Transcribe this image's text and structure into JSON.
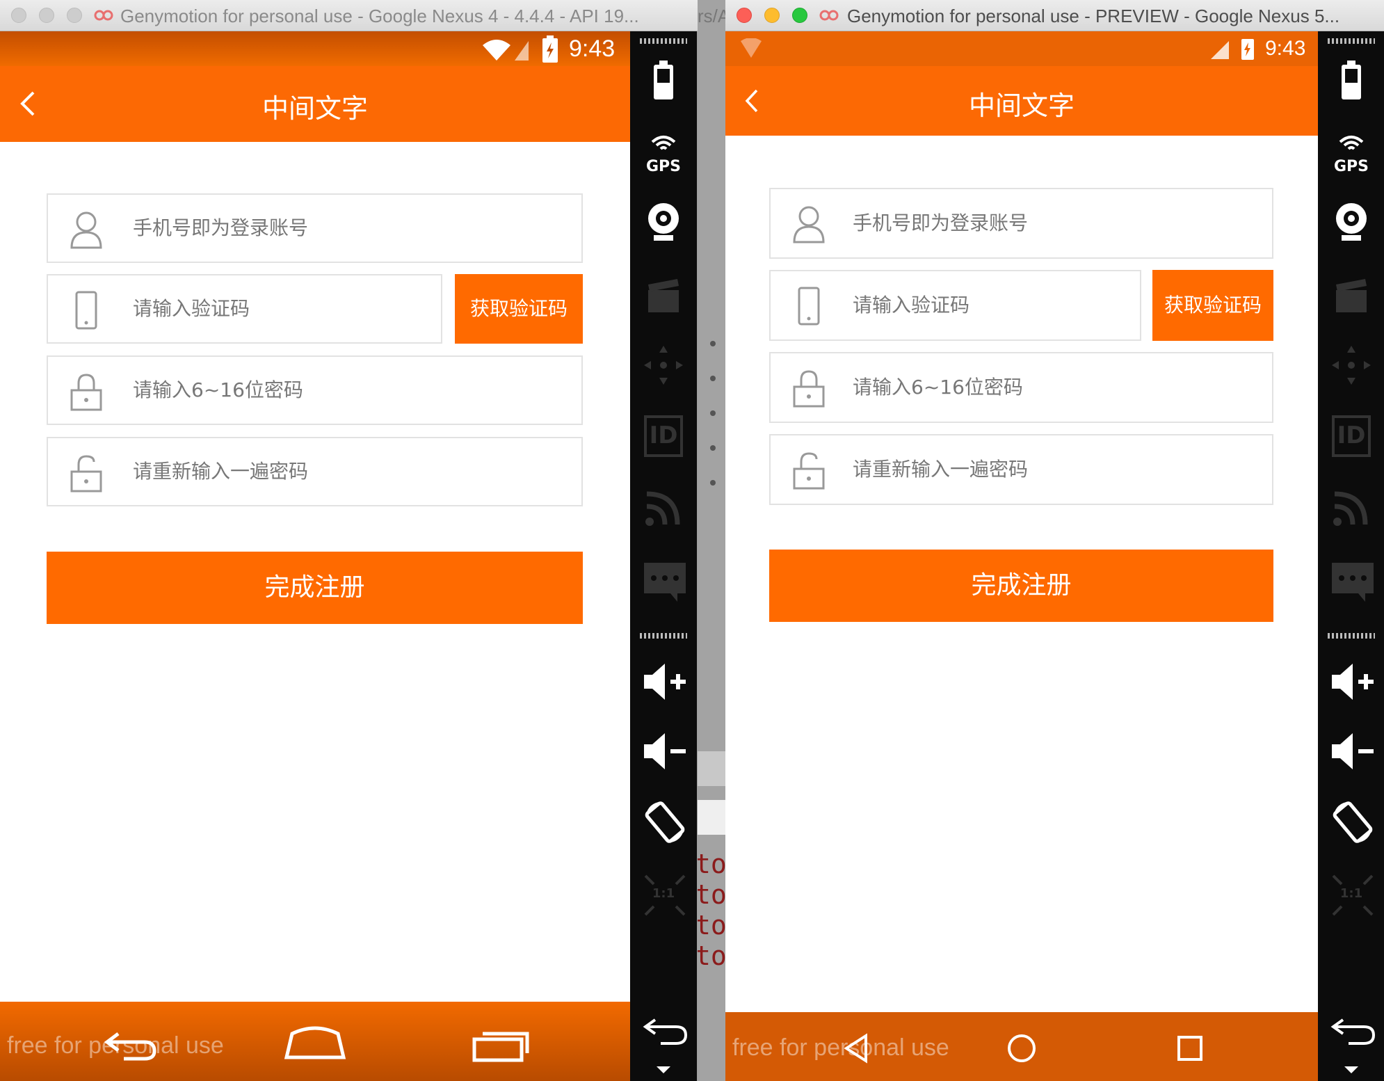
{
  "left_window": {
    "title": "Genymotion for personal use - Google Nexus 4 - 4.4.4 - API 19...",
    "status_time": "9:43",
    "app_title": "中间文字",
    "fields": {
      "phone_placeholder": "手机号即为登录账号",
      "code_placeholder": "请输入验证码",
      "password_placeholder": "请输入6~16位密码",
      "confirm_placeholder": "请重新输入一遍密码"
    },
    "get_code_label": "获取验证码",
    "submit_label": "完成注册",
    "watermark": "free for personal use",
    "sidebar_gps_label": "GPS",
    "sidebar_id_label": "ID",
    "sidebar_scale_label": "1:1"
  },
  "right_window": {
    "title": "Genymotion for personal use - PREVIEW - Google Nexus 5...",
    "status_time": "9:43",
    "app_title": "中间文字",
    "fields": {
      "phone_placeholder": "手机号即为登录账号",
      "code_placeholder": "请输入验证码",
      "password_placeholder": "请输入6~16位密码",
      "confirm_placeholder": "请重新输入一遍密码"
    },
    "get_code_label": "获取验证码",
    "submit_label": "完成注册",
    "watermark": "free for personal use",
    "sidebar_gps_label": "GPS",
    "sidebar_id_label": "ID",
    "sidebar_scale_label": "1:1"
  },
  "background_window": {
    "fragments": [
      "rs/A",
      "rs/A"
    ],
    "code_lines": [
      "tol",
      "tol",
      "tol",
      "tol"
    ]
  },
  "colors": {
    "accent": "#ff6a00",
    "statusbar_left": "#c34e00",
    "statusbar_right": "#ea6404",
    "field_border": "#e2e2e2",
    "placeholder": "#777777",
    "sidebar": "#0c0c0c"
  }
}
